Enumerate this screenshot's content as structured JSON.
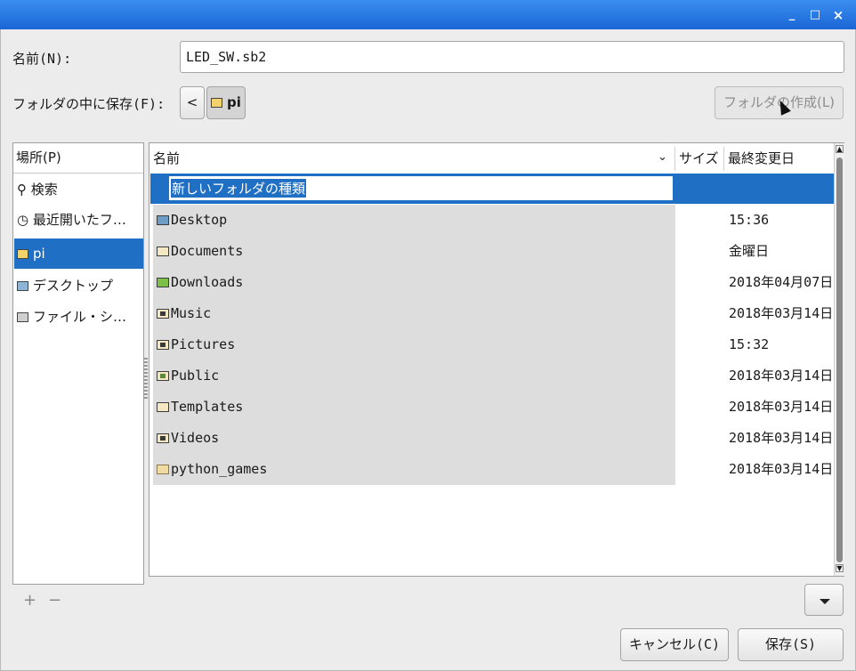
{
  "window": {
    "controls": {
      "minimize": "_",
      "maximize": "□",
      "close": "×"
    }
  },
  "name_label": "名前(N):",
  "name_value": "LED_SW.sb2",
  "folder_label": "フォルダの中に保存(F):",
  "path_back": "<",
  "path_current": "pi",
  "create_folder_label": "フォルダの作成(L)",
  "places": {
    "header": "場所(P)",
    "items": [
      {
        "label": "検索",
        "icon": "search-icon"
      },
      {
        "label": "最近開いたフ…",
        "icon": "recent-icon"
      },
      {
        "label": "pi",
        "icon": "home-icon"
      },
      {
        "label": "デスクトップ",
        "icon": "desktop-icon"
      },
      {
        "label": "ファイル・シ…",
        "icon": "drive-icon"
      }
    ],
    "add": "+",
    "remove": "−"
  },
  "columns": {
    "name": "名前",
    "size": "サイズ",
    "modified": "最終変更日"
  },
  "new_folder_placeholder": "新しいフォルダの種類",
  "files": [
    {
      "name": "Desktop",
      "modified": "15:36"
    },
    {
      "name": "Documents",
      "modified": "金曜日"
    },
    {
      "name": "Downloads",
      "modified": "2018年04月07日"
    },
    {
      "name": "Music",
      "modified": "2018年03月14日"
    },
    {
      "name": "Pictures",
      "modified": "15:32"
    },
    {
      "name": "Public",
      "modified": "2018年03月14日"
    },
    {
      "name": "Templates",
      "modified": "2018年03月14日"
    },
    {
      "name": "Videos",
      "modified": "2018年03月14日"
    },
    {
      "name": "python_games",
      "modified": "2018年03月14日"
    }
  ],
  "cancel_label": "キャンセル(C)",
  "save_label": "保存(S)",
  "colors": {
    "titlebar": "#1b66d6",
    "selection": "#1f6fc5"
  }
}
